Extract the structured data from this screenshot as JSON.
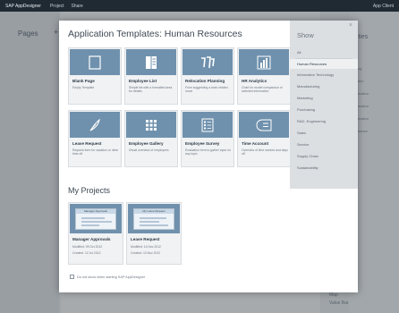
{
  "shell": {
    "app_name": "SAP AppDesigner",
    "menu": [
      "Project",
      "Share"
    ],
    "user": "App Client"
  },
  "background": {
    "pages_label": "Pages",
    "plus": "+",
    "props_label": "rties",
    "list": [
      "ng",
      "tion",
      "mation",
      "mation",
      "mation",
      "bance"
    ],
    "footer": [
      "Map",
      "Value Bar"
    ]
  },
  "dialog": {
    "title": "Application Templates: Human Resources",
    "close": "×",
    "templates": [
      {
        "name": "Blank Page",
        "desc": "Empty Template",
        "icon": "page-icon"
      },
      {
        "name": "Employee List",
        "desc": "Simple list with a formatted area for details",
        "icon": "list-icon"
      },
      {
        "name": "Relocation Planning",
        "desc": "From suggesting a work related move",
        "icon": "truck-icon"
      },
      {
        "name": "HR Analytics",
        "desc": "Chart for model comparison of selected information",
        "icon": "bar-chart-icon"
      },
      {
        "name": "Leave Request",
        "desc": "Request form for vacation or other time off",
        "icon": "feather-icon"
      },
      {
        "name": "Employee Gallery",
        "desc": "Visual overview of employees",
        "icon": "grid-icon"
      },
      {
        "name": "Employee Survey",
        "desc": "Evaluation form to gather input on any topic",
        "icon": "form-icon"
      },
      {
        "name": "Time Account",
        "desc": "Overview of time worked and days off",
        "icon": "time-account-icon"
      }
    ],
    "projects_heading": "My Projects",
    "projects": [
      {
        "name": "Manager Approvals",
        "modified": "Modified: 09 Oct 2012",
        "created": "Created: 12 Jul 2012",
        "thumb_title": "Manager Approvals"
      },
      {
        "name": "Leave Request",
        "modified": "Modified: 14 Nov 2012",
        "created": "Created: 10 Nov 2012",
        "thumb_title": "My Leave Request"
      }
    ],
    "checkbox_label": "Do not show when starting SAP AppDesigner",
    "filter": {
      "title": "Show",
      "items": [
        "All",
        "Human Resources",
        "Information Technology",
        "Manufacturing",
        "Marketing",
        "Purchasing",
        "R&D, Engineering",
        "Sales",
        "Service",
        "Supply Chain",
        "Sustainability"
      ],
      "selected": "Human Resources"
    }
  },
  "colors": {
    "thumb": "#6f91ad",
    "shell": "#1f2a33",
    "sidebar": "#dcdfe2"
  }
}
